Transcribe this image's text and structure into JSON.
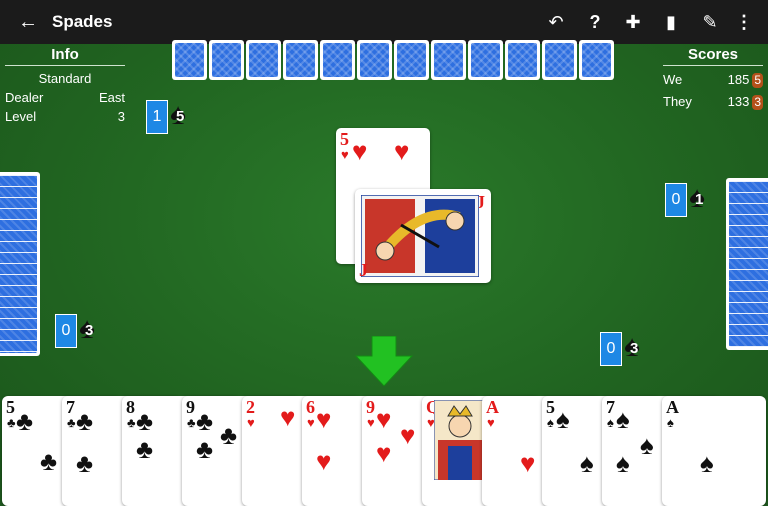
{
  "app": {
    "title": "Spades",
    "back_icon": "arrow-left-icon"
  },
  "toolbar": [
    "undo-icon",
    "help-icon",
    "dpad-icon",
    "cards-icon",
    "scoresheet-icon",
    "more-vert-icon"
  ],
  "info": {
    "header": "Info",
    "mode": "Standard",
    "dealer_label": "Dealer",
    "dealer_value": "East",
    "level_label": "Level",
    "level_value": "3"
  },
  "scores": {
    "header": "Scores",
    "we_label": "We",
    "we_score": "185",
    "we_bags": "5",
    "they_label": "They",
    "they_score": "133",
    "they_bags": "3"
  },
  "bids": {
    "north": {
      "tricks": "1",
      "bid": "5"
    },
    "west": {
      "tricks": "0",
      "bid": "3"
    },
    "east": {
      "tricks": "0",
      "bid": "1"
    },
    "south": {
      "tricks": "0",
      "bid": "3"
    }
  },
  "trick": {
    "card1": {
      "rank": "5",
      "suit": "♥"
    },
    "card2": {
      "rank": "J",
      "suit": "♥"
    }
  },
  "hand": [
    {
      "rank": "5",
      "suit": "♣"
    },
    {
      "rank": "7",
      "suit": "♣"
    },
    {
      "rank": "8",
      "suit": "♣"
    },
    {
      "rank": "9",
      "suit": "♣"
    },
    {
      "rank": "2",
      "suit": "♥"
    },
    {
      "rank": "6",
      "suit": "♥"
    },
    {
      "rank": "9",
      "suit": "♥"
    },
    {
      "rank": "Q",
      "suit": "♥"
    },
    {
      "rank": "A",
      "suit": "♥"
    },
    {
      "rank": "5",
      "suit": "♠"
    },
    {
      "rank": "7",
      "suit": "♠"
    },
    {
      "rank": "A",
      "suit": "♠"
    }
  ],
  "colors": {
    "felt": "#216521",
    "bid_blue": "#1e88e5",
    "bag_badge": "#b4511a",
    "card_back": "#2e6fe0",
    "red_suit": "#e31b1b",
    "arrow": "#22c122"
  }
}
